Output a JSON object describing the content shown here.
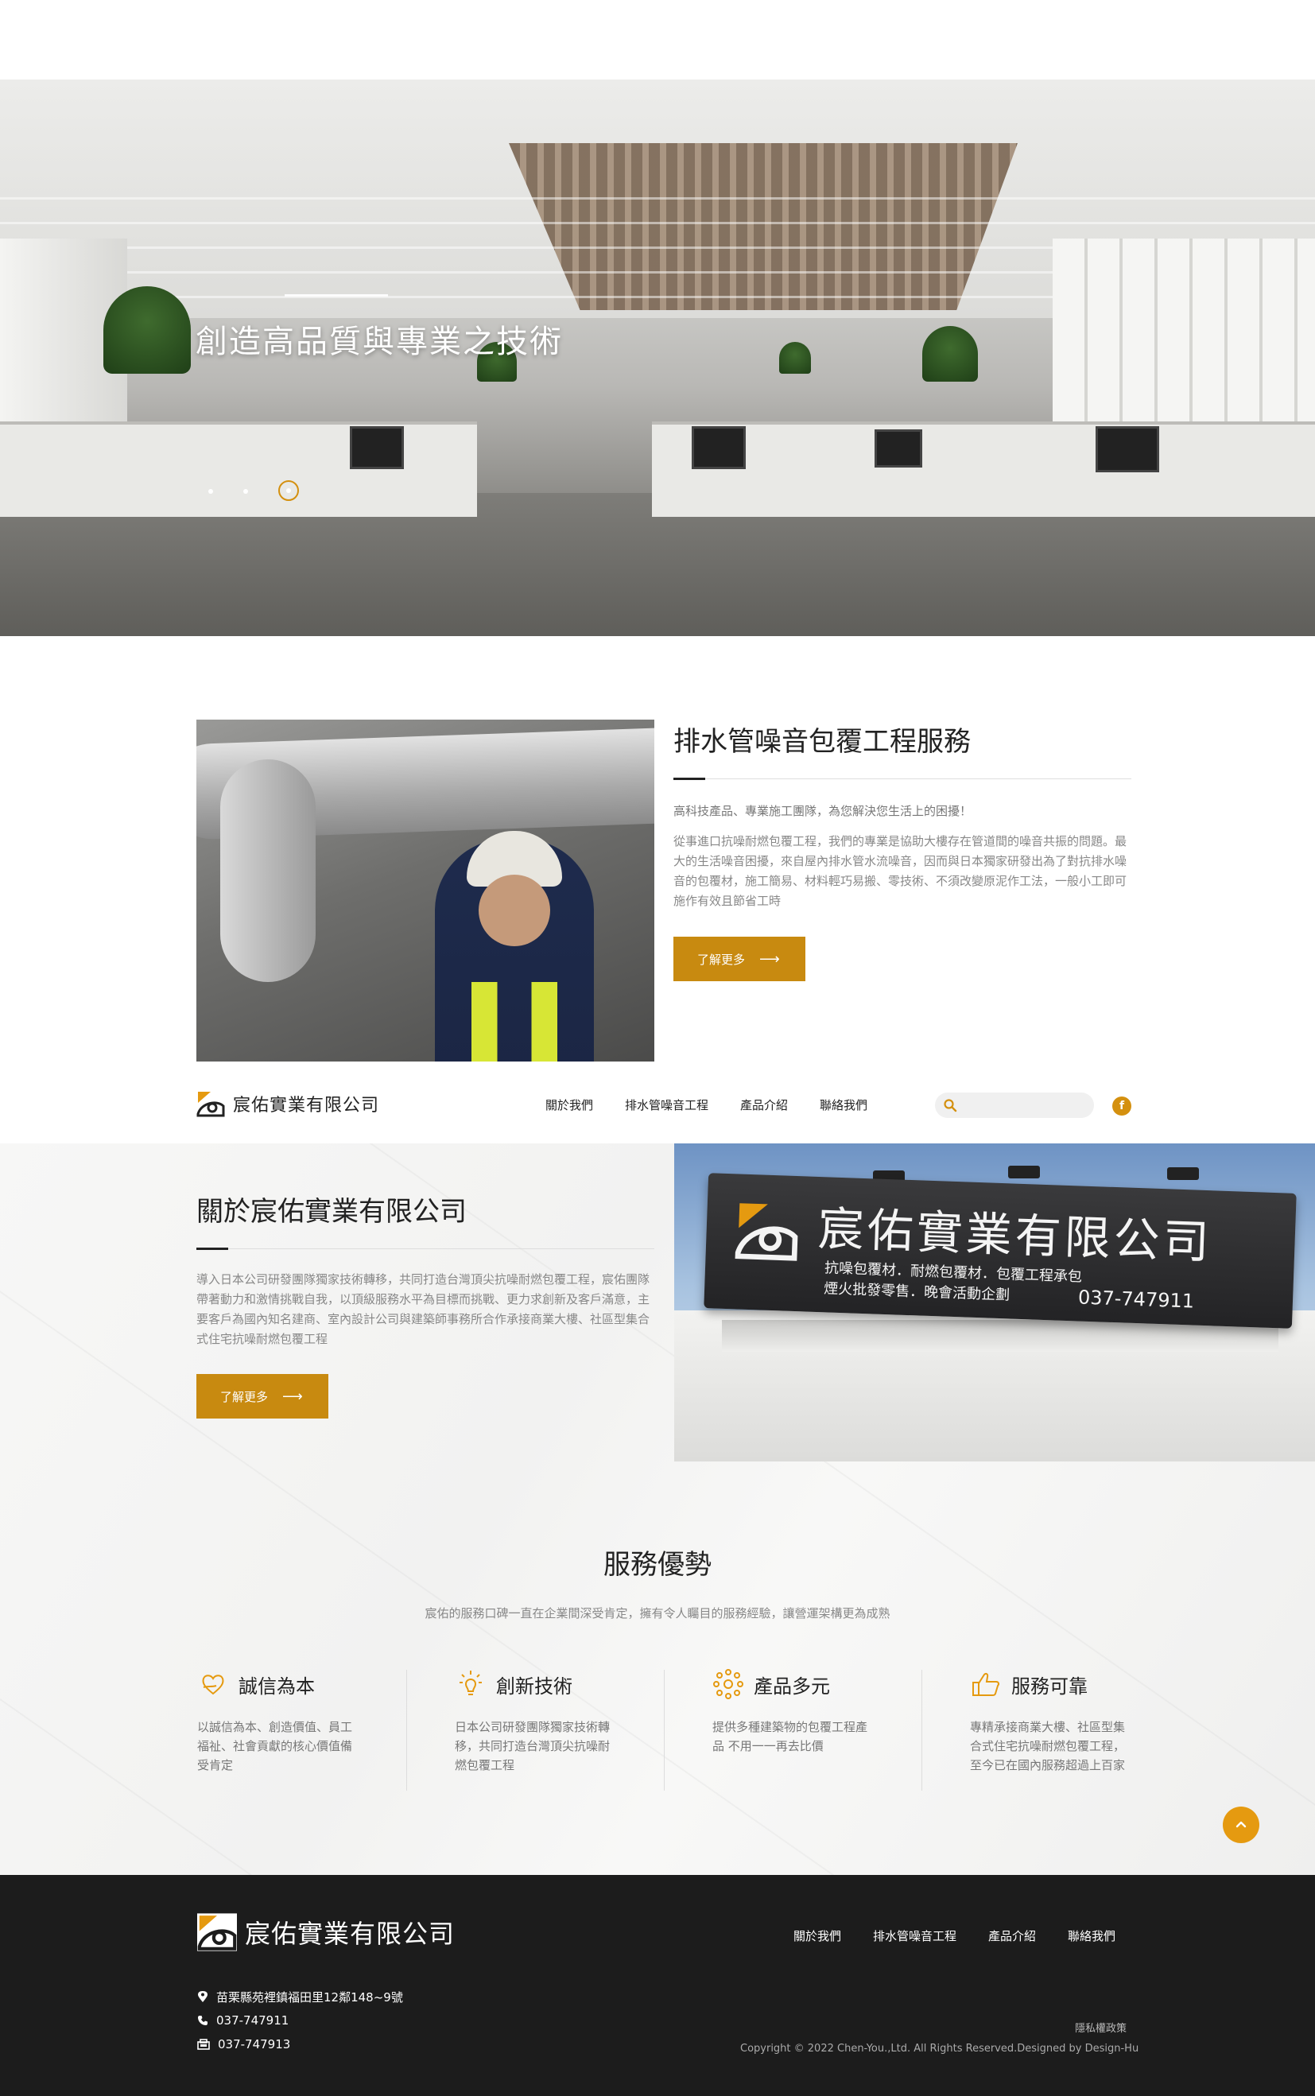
{
  "hero": {
    "caption": "創造高品質與專業之技術",
    "slides": 3,
    "active_slide": 3
  },
  "service": {
    "title": "排水管噪音包覆工程服務",
    "lead": "高科技產品、專業施工團隊，為您解決您生活上的困擾！",
    "body": "從事進口抗噪耐燃包覆工程，我們的專業是協助大樓存在管道間的噪音共振的問題。最大的生活噪音困擾，來自屋內排水管水流噪音，因而與日本獨家研發出為了對抗排水噪音的包覆材，施工簡易、材料輕巧易搬、零技術、不須改變原泥作工法，一般小工即可施作有效且節省工時",
    "button_label": "了解更多",
    "button_arrow": "⟶"
  },
  "nav": {
    "logo_text": "宸佑實業有限公司",
    "items": [
      "關於我們",
      "排水管噪音工程",
      "產品介紹",
      "聯絡我們"
    ],
    "search_placeholder": "",
    "facebook_glyph": "f"
  },
  "about": {
    "title": "關於宸佑實業有限公司",
    "body": "導入日本公司研發團隊獨家技術轉移，共同打造台灣頂尖抗噪耐燃包覆工程，宸佑團隊帶著動力和激情挑戰自我，以頂級服務水平為目標而挑戰、更力求創新及客戶滿意，主要客戶為國內知名建商、室內設計公司與建築師事務所合作承接商業大樓、社區型集合式住宅抗噪耐燃包覆工程",
    "button_label": "了解更多",
    "sign_name": "宸佑實業有限公司",
    "sign_sub_1": "抗噪包覆材．耐燃包覆材．包覆工程承包",
    "sign_sub_2": "煙火批發零售．晚會活動企劃",
    "sign_phone": "037-747911"
  },
  "advantages": {
    "title": "服務優勢",
    "subtitle": "宸佑的服務口碑一直在企業間深受肯定，擁有令人矚目的服務經驗，讓營運架構更為成熟",
    "items": [
      {
        "title": "誠信為本",
        "text": "以誠信為本、創造價值、員工福祉、社會貢獻的核心價值備受肯定",
        "icon": "heart-hand-icon"
      },
      {
        "title": "創新技術",
        "text": "日本公司研發團隊獨家技術轉移，共同打造台灣頂尖抗噪耐燃包覆工程",
        "icon": "lightbulb-icon"
      },
      {
        "title": "產品多元",
        "text": "提供多種建築物的包覆工程產品 不用一一再去比價",
        "icon": "network-icon"
      },
      {
        "title": "服務可靠",
        "text": "專精承接商業大樓、社區型集合式住宅抗噪耐燃包覆工程，至今已在國內服務超過上百家",
        "icon": "thumbs-up-icon"
      }
    ]
  },
  "footer": {
    "logo_text": "宸佑實業有限公司",
    "menu": [
      "關於我們",
      "排水管噪音工程",
      "產品介紹",
      "聯絡我們"
    ],
    "address": "苗栗縣苑裡鎮福田里12鄰148~9號",
    "phone": "037-747911",
    "fax": "037-747913",
    "privacy": "隱私權政策",
    "copyright": "Copyright © 2022 Chen-You.,Ltd. All Rights Reserved.Designed by Design-Hu"
  },
  "colors": {
    "accent": "#c88a10",
    "accent_bright": "#e59a10",
    "footer_bg": "#1c1c1c"
  }
}
